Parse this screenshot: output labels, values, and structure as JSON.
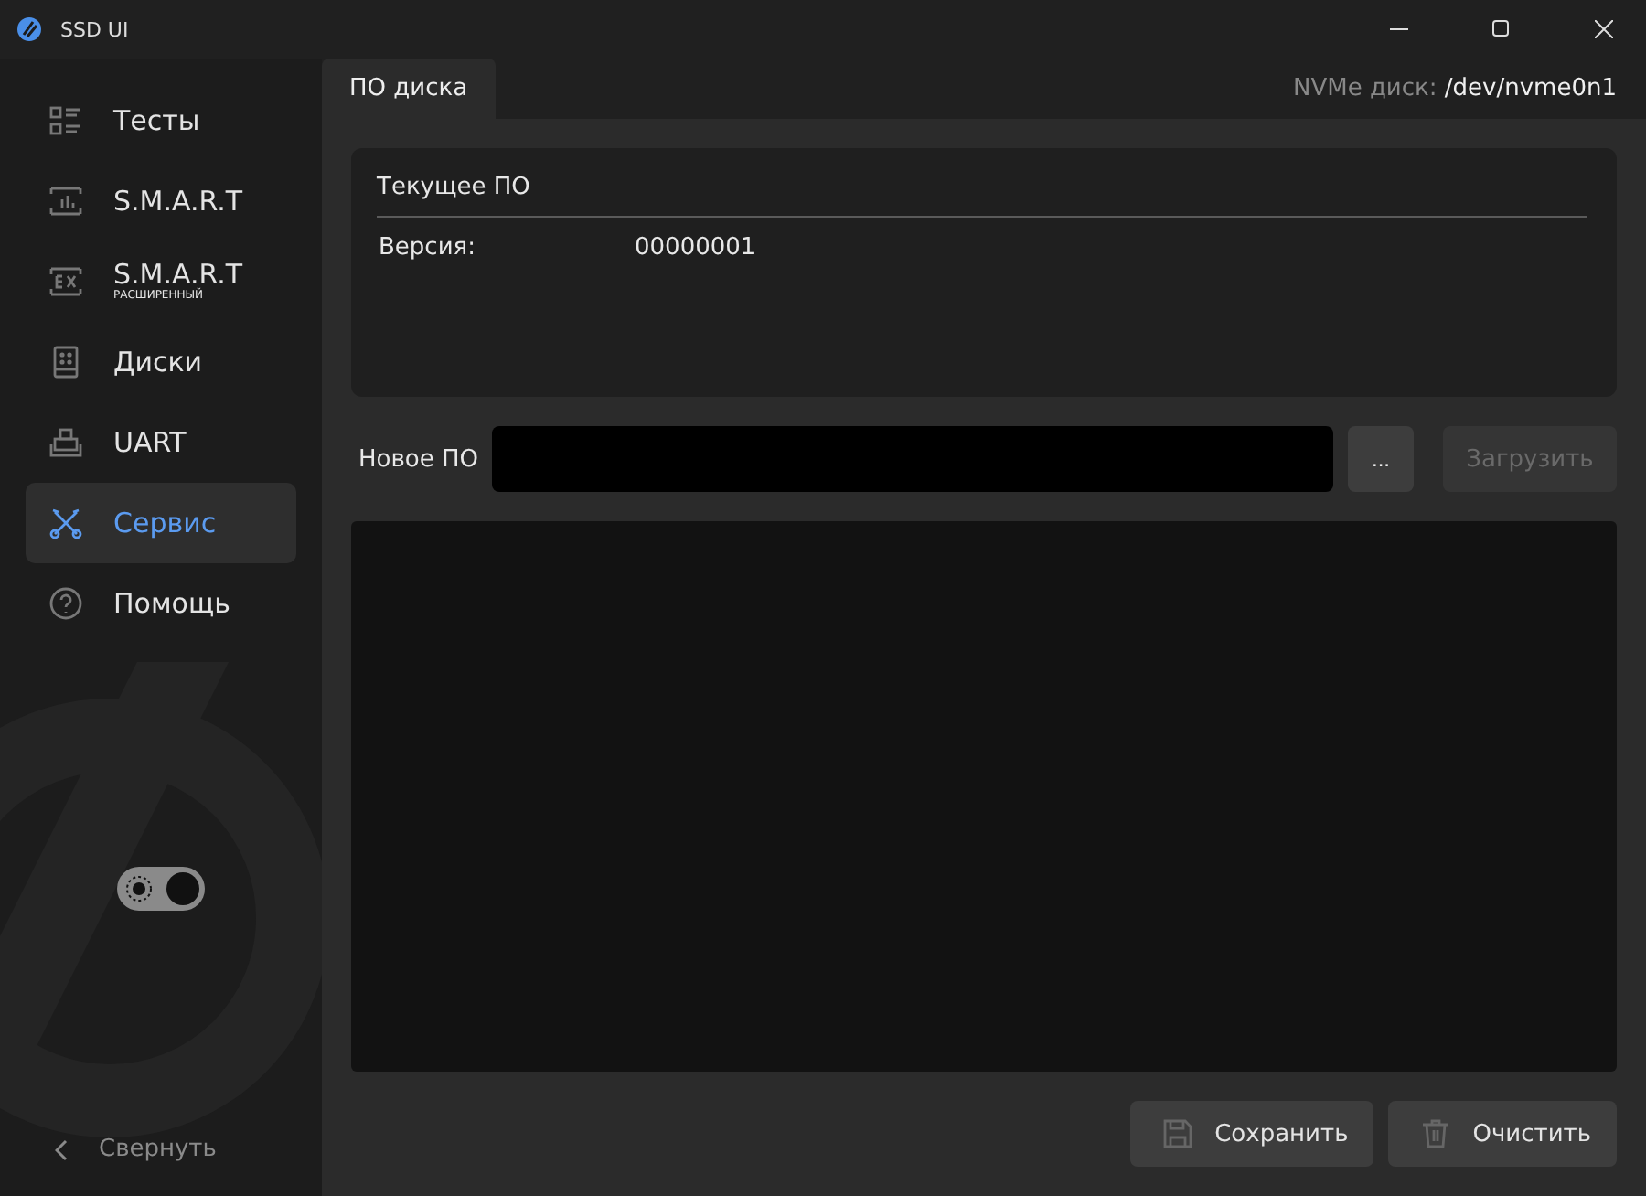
{
  "window": {
    "title": "SSD UI"
  },
  "sidebar": {
    "items": [
      {
        "label": "Тесты",
        "kind": "tests",
        "selected": false
      },
      {
        "label": "S.M.A.R.T",
        "kind": "smart",
        "selected": false
      },
      {
        "label": "S.M.A.R.T",
        "sublabel": "РАСШИРЕННЫЙ",
        "kind": "smart-ex",
        "selected": false
      },
      {
        "label": "Диски",
        "kind": "disks",
        "selected": false
      },
      {
        "label": "UART",
        "kind": "uart",
        "selected": false
      },
      {
        "label": "Сервис",
        "kind": "service",
        "selected": true
      },
      {
        "label": "Помощь",
        "kind": "help",
        "selected": false
      }
    ],
    "theme_toggle": {
      "on": true
    },
    "collapse": "Свернуть"
  },
  "tabs": [
    {
      "label": "ПО диска",
      "selected": true
    }
  ],
  "device": {
    "label": "NVMe диск:",
    "value": "/dev/nvme0n1"
  },
  "current_firmware": {
    "title": "Текущее ПО",
    "fields": [
      {
        "label": "Версия:",
        "value": "00000001"
      }
    ]
  },
  "new_firmware": {
    "label": "Новое ПО",
    "browse": "...",
    "upload": {
      "label": "Загрузить",
      "disabled": true
    }
  },
  "actions": [
    {
      "label": "Сохранить",
      "kind": "save"
    },
    {
      "label": "Очистить",
      "kind": "clear"
    }
  ]
}
